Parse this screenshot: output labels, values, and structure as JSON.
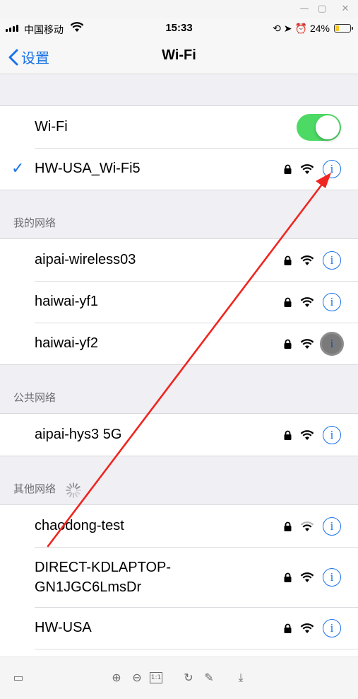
{
  "status_bar": {
    "carrier": "中国移动",
    "time": "15:33",
    "battery": "24%",
    "battery_level": 0.24
  },
  "nav": {
    "back_label": "设置",
    "title": "Wi-Fi"
  },
  "wifi_toggle": {
    "label": "Wi-Fi",
    "on": true
  },
  "connected": {
    "name": "HW-USA_Wi-Fi5"
  },
  "my_networks": {
    "header": "我的网络",
    "items": [
      "aipai-wireless03",
      "haiwai-yf1",
      "haiwai-yf2"
    ]
  },
  "public_networks": {
    "header": "公共网络",
    "items": [
      "aipai-hys3 5G"
    ]
  },
  "other_networks": {
    "header": "其他网络",
    "items": [
      "chaodong-test",
      "DIRECT-KDLAPTOP-\nGN1JGC6LmsDr",
      "HW-USA"
    ]
  },
  "colors": {
    "accent": "#1a73e8",
    "toggle_on": "#4cd964",
    "annotation_arrow": "#f0251f"
  },
  "icons": {
    "window": [
      "minimize-icon",
      "maximize-icon",
      "close-icon"
    ],
    "toolbar": [
      "layout-icon",
      "zoom-in-icon",
      "zoom-out-icon",
      "actual-size-icon",
      "rotate-icon",
      "edit-icon",
      "download-icon"
    ]
  },
  "toolbar": {
    "actual_size_label": "1:1"
  }
}
